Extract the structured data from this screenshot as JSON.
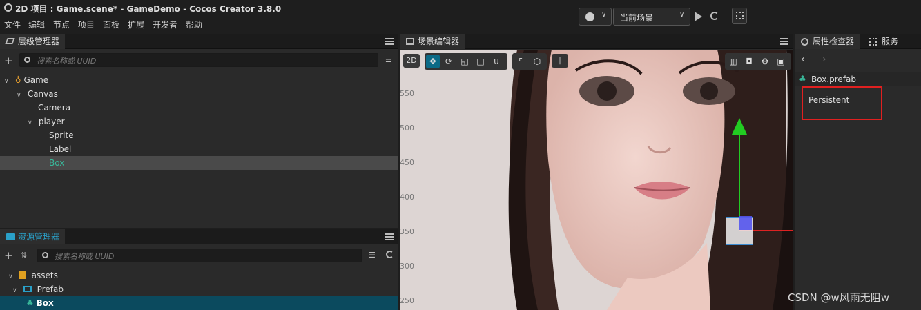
{
  "title": "2D 项目 : Game.scene* - GameDemo - Cocos Creator 3.8.0",
  "menu": [
    "文件",
    "编辑",
    "节点",
    "项目",
    "面板",
    "扩展",
    "开发者",
    "帮助"
  ],
  "toolbar": {
    "scene_select": "当前场景"
  },
  "hierarchy": {
    "tab": "层级管理器",
    "search_placeholder": "搜索名称或 UUID",
    "nodes": [
      "Game",
      "Canvas",
      "Camera",
      "player",
      "Sprite",
      "Label",
      "Box"
    ]
  },
  "scene": {
    "tab": "场景编辑器",
    "btn_2d": "2D",
    "ruler": [
      "550",
      "500",
      "450",
      "400",
      "350",
      "300",
      "250"
    ]
  },
  "assets": {
    "tab": "资源管理器",
    "search_placeholder": "搜索名称或 UUID",
    "items": [
      "assets",
      "Prefab",
      "Box"
    ]
  },
  "inspector": {
    "tab": "属性检查器",
    "tab2": "服务",
    "asset_name": "Box.prefab",
    "flag": "Persistent"
  },
  "watermark": "CSDN @w风雨无阻w",
  "colors": {
    "accent": "#2aa0c8",
    "selected_text": "#39b89a",
    "gizmo_y": "#22cc22",
    "gizmo_x": "#dd2222",
    "highlight_box": "#e02020"
  }
}
